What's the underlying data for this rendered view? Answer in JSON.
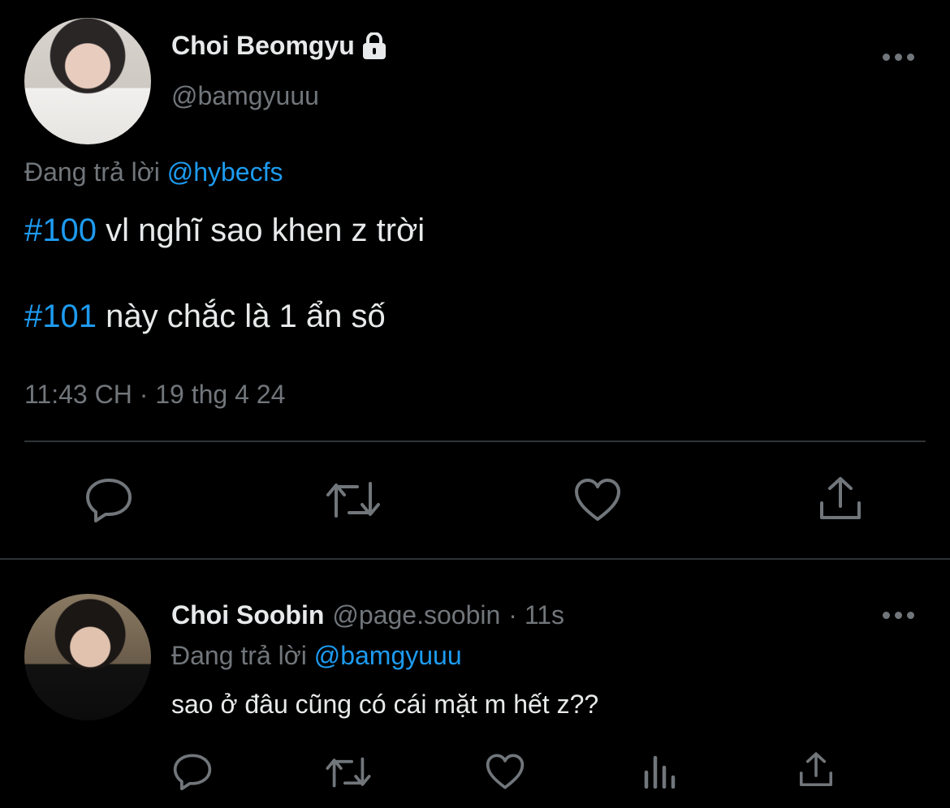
{
  "tweet": {
    "display_name": "Choi Beomgyu",
    "handle": "@bamgyuuu",
    "reply_prefix": "Đang trả lời",
    "reply_to": "@hybecfs",
    "lines": [
      {
        "tag": "#100",
        "text": " vl nghĩ sao khen z trời"
      },
      {
        "tag": "#101",
        "text": " này chắc là 1 ẩn số"
      }
    ],
    "timestamp": "11:43 CH · 19 thg 4 24",
    "actions": [
      "reply-icon",
      "retweet-icon",
      "like-icon",
      "share-icon"
    ]
  },
  "reply": {
    "display_name": "Choi Soobin",
    "handle": "@page.soobin",
    "time": "· 11s",
    "reply_prefix": "Đang trả lời",
    "reply_to": "@bamgyuuu",
    "text": "sao ở đâu cũng có cái mặt m hết z??",
    "actions": [
      "reply-icon",
      "retweet-icon",
      "like-icon",
      "analytics-icon",
      "share-icon"
    ]
  },
  "colors": {
    "background": "#000000",
    "text": "#e7e9ea",
    "secondary": "#71767b",
    "accent": "#1d9bf0",
    "divider": "#2f3336"
  }
}
